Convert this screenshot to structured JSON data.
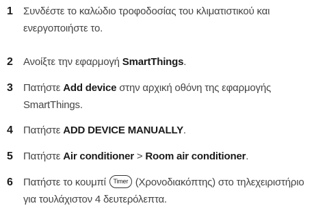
{
  "steps": [
    {
      "number": "1",
      "text": "Συνδέστε το καλώδιο τροφοδοσίας του κλιματιστικού και ενεργοποιήστε το."
    },
    {
      "number": "2",
      "prefix": "Ανοίξτε την εφαρμογή ",
      "bold": "SmartThings",
      "suffix": "."
    },
    {
      "number": "3",
      "prefix": "Πατήστε ",
      "bold": "Add device",
      "suffix": " στην αρχική οθόνη της εφαρμογής SmartThings."
    },
    {
      "number": "4",
      "prefix": "Πατήστε ",
      "bold": "ADD DEVICE MANUALLY",
      "suffix": "."
    },
    {
      "number": "5",
      "prefix": "Πατήστε ",
      "bold1": "Air conditioner",
      "separator": " > ",
      "bold2": "Room air conditioner",
      "suffix": "."
    },
    {
      "number": "6",
      "prefix": "Πατήστε το κουμπί ",
      "button_label": "Timer",
      "suffix": " (Χρονοδιακόπτης) στο τηλεχειριστήριο για τουλάχιστον 4 δευτερόλεπτα."
    }
  ]
}
